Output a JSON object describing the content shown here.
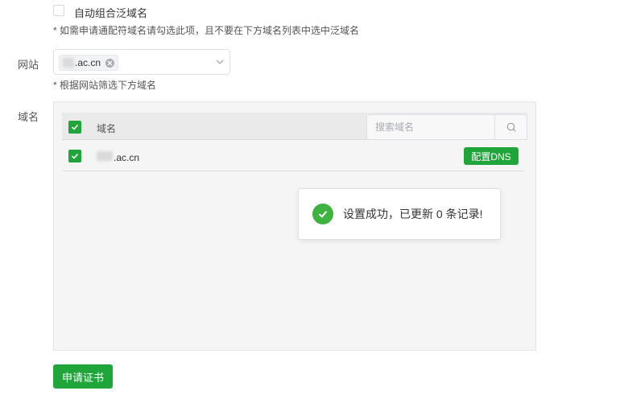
{
  "wildcard": {
    "checkbox_label": "自动组合泛域名",
    "checked": false,
    "note": "* 如需申请通配符域名请勾选此项，且不要在下方域名列表中选中泛域名"
  },
  "site": {
    "label": "网站",
    "selected_tag": ".ac.cn",
    "note": "* 根据网站筛选下方域名"
  },
  "domains": {
    "label": "域名",
    "header_checked": true,
    "column_header": "域名",
    "search_placeholder": "搜索域名",
    "rows": [
      {
        "checked": true,
        "domain": ".ac.cn",
        "action_label": "配置DNS"
      }
    ]
  },
  "toast": {
    "message": "设置成功，已更新 0 条记录!"
  },
  "footer": {
    "apply_label": "申请证书"
  },
  "colors": {
    "accent_green": "#20a53a",
    "success_icon": "#3fb33f",
    "panel_bg": "#f5f5f5"
  }
}
